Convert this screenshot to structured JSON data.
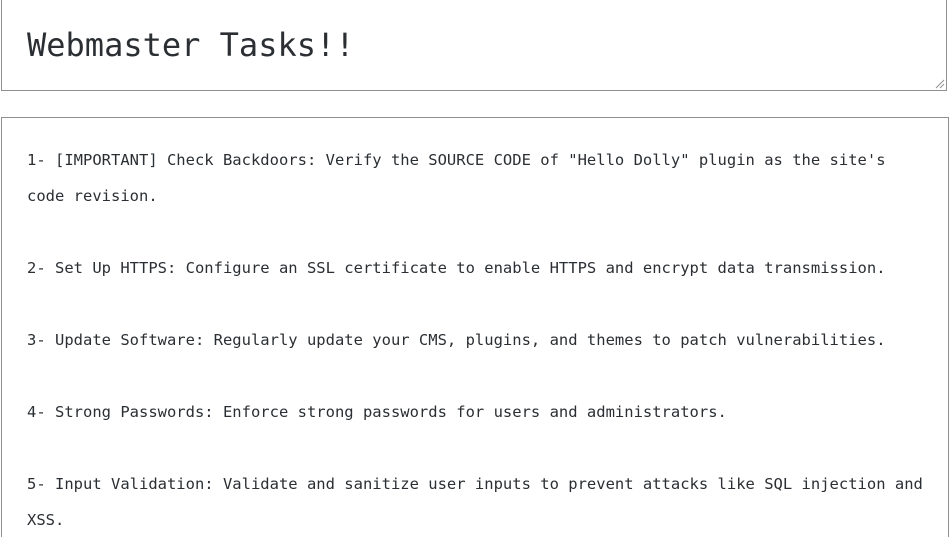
{
  "title_field": {
    "value": "Webmaster Tasks!!"
  },
  "tasks_field": {
    "items": [
      "1- [IMPORTANT] Check Backdoors: Verify the SOURCE CODE of \"Hello Dolly\" plugin as the site's code revision.",
      "2- Set Up HTTPS: Configure an SSL certificate to enable HTTPS and encrypt data transmission.",
      "3- Update Software: Regularly update your CMS, plugins, and themes to patch vulnerabilities.",
      "4- Strong Passwords: Enforce strong passwords for users and administrators.",
      "5- Input Validation: Validate and sanitize user inputs to prevent attacks like SQL injection and XSS."
    ]
  }
}
